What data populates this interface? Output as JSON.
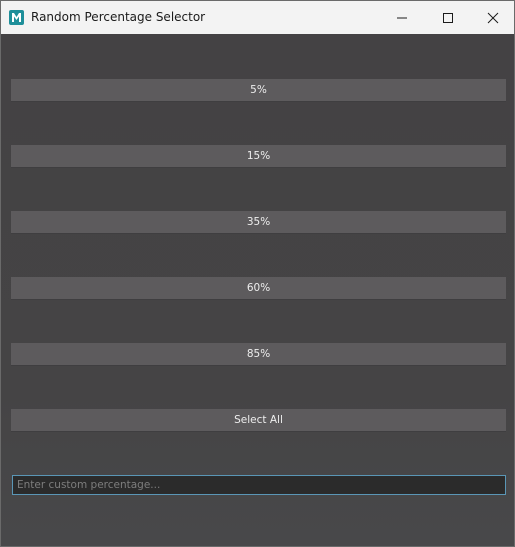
{
  "window": {
    "title": "Random Percentage Selector",
    "app_icon": "maya-m-icon",
    "controls": {
      "minimize": "minimize-icon",
      "maximize": "maximize-icon",
      "close": "close-icon"
    }
  },
  "buttons": [
    {
      "label": "5%"
    },
    {
      "label": "15%"
    },
    {
      "label": "35%"
    },
    {
      "label": "60%"
    },
    {
      "label": "85%"
    },
    {
      "label": "Select All"
    }
  ],
  "custom_input": {
    "value": "",
    "placeholder": "Enter custom percentage..."
  },
  "colors": {
    "background": "#444244",
    "button": "#5d5b5d",
    "button_text": "#eeeeee",
    "input_background": "#2b2b2b",
    "input_focus_border": "#5a96b6",
    "titlebar": "#f3f3f3",
    "app_icon": "#1f8f9a"
  }
}
